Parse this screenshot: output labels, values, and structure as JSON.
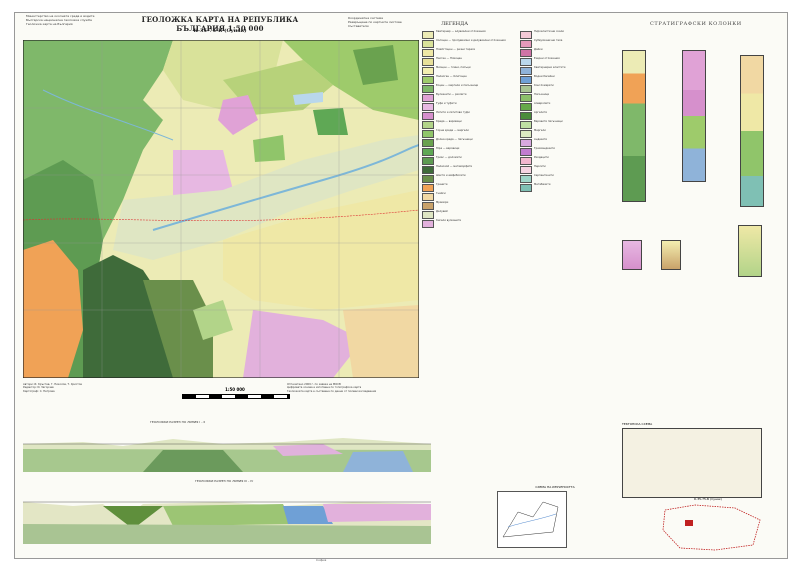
{
  "header": {
    "org_line1": "Министерство на околната среда и водите",
    "org_line2": "Българска национална геоложка служба",
    "org_line3": "Геоложка карта на България",
    "title": "ГЕОЛОЖКА КАРТА НА РЕПУБЛИКА БЪЛГАРИЯ 1:50 000",
    "sheet": "К-35-75-Б (Сунак)",
    "right_line1": "Координатна система",
    "right_line2": "Развръщане по картните листове",
    "right_line3": "Съставители"
  },
  "legend": {
    "title": "ЛЕГЕНДА",
    "items": [
      "Кватернер — алувиални отложения",
      "Холоцен — пролувиални и делувиални отложения",
      "Плейстоцен — речни тераси",
      "Неоген — Плиоцен",
      "Миоцен — глини, пясъци",
      "Палеоген — Олигоцен",
      "Еоцен — мергели и пясъчници",
      "Вулканити — риолити",
      "Туфи и туфити",
      "Латити и латитови туфи",
      "Креда — варовици",
      "Горна креда — мергели",
      "Долна креда — пясъчници",
      "Юра — варовици",
      "Триас — доломити",
      "Палеозой — метаморфити",
      "Шисти и амфиболити",
      "Гранити",
      "Гнайси",
      "Мрамори",
      "Делувий",
      "Кисели вулканити",
      "Пирокластични скали",
      "Субвулканични тела",
      "Дайки",
      "Езерни отложения",
      "Кватернерни кластити",
      "Водни басейни",
      "Конгломерати",
      "Пясъчници",
      "Алевролити",
      "Аргилити",
      "Варовити пясъчници",
      "Мергели",
      "Андезити",
      "Трахиандезити",
      "Риодацити",
      "Перлити",
      "Серпентинити",
      "Метабазити"
    ]
  },
  "stratigraphy": {
    "title": "СТРАТИГРАФСКИ КОЛОНКИ"
  },
  "map_notes": {
    "authors_1": "Автори: И. Кръстев, Г. Николов, Т. Христов",
    "authors_2": "Редактор: И. Загорчев",
    "authors_3": "Картограф: С. Петрова",
    "scale": "1:50 000",
    "note_1": "Отпечатано 2009 г. по заявка на МОСВ",
    "note_2": "Цифровата основа е изготвена по топографска карта",
    "note_3": "Геоложката карта е съставена по данни от полеви изследвания"
  },
  "sections": {
    "title_1": "ГЕОЛОЖКИ РАЗРЕЗ ПО ЛИНИЯ I – II",
    "title_2": "ГЕОЛОЖКИ РАЗРЕЗ ПО ЛИНИЯ III – IV"
  },
  "index_map": {
    "title": "СХЕМА НА ИЗУЧЕНОСТТА"
  },
  "structure": {
    "title": "ТЕКТОНСКА СХЕМА"
  },
  "locator": {
    "title": "К-35-75-Б (Сунак)"
  },
  "footer": {
    "note": "София"
  },
  "colors": {
    "quaternary": "#ecebb5",
    "volcanics": "#e0a2d6",
    "paleogene": "#7fb86a",
    "granite": "#f0a256",
    "metamorphic": "#3f6b3a",
    "river": "#7db7d8"
  }
}
